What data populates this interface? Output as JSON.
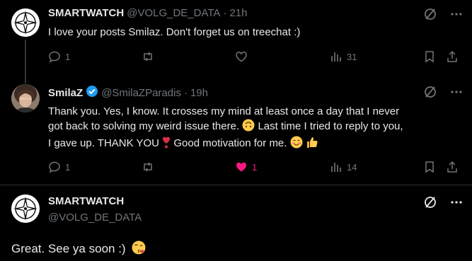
{
  "tweets": [
    {
      "name": "SMARTWATCH",
      "handle": "@VOLG_DE_DATA",
      "time": "21h",
      "text": "I love your posts Smilaz. Don't forget us on treechat :)",
      "replies": "1",
      "likes": "",
      "views": "31"
    },
    {
      "name": "SmilaZ",
      "handle": "@SmilaZParadis",
      "time": "19h",
      "text_line1": "Thank you. Yes, I know. It crosses my mind at least once a day that I never",
      "text_line2a": "got back to solving my weird issue there.",
      "text_line2b": "Last time I tried to reply to you,",
      "text_line3a": "I gave up. THANK YOU",
      "text_line3b": "Good motivation for me.",
      "replies": "1",
      "likes": "1",
      "views": "14"
    },
    {
      "name": "SMARTWATCH",
      "handle": "@VOLG_DE_DATA",
      "text": "Great. See ya soon :)"
    }
  ],
  "colors": {
    "background": "#000000",
    "text": "#e7e9ea",
    "secondary": "#71767b",
    "like": "#f91880",
    "verified": "#1d9bf0"
  }
}
